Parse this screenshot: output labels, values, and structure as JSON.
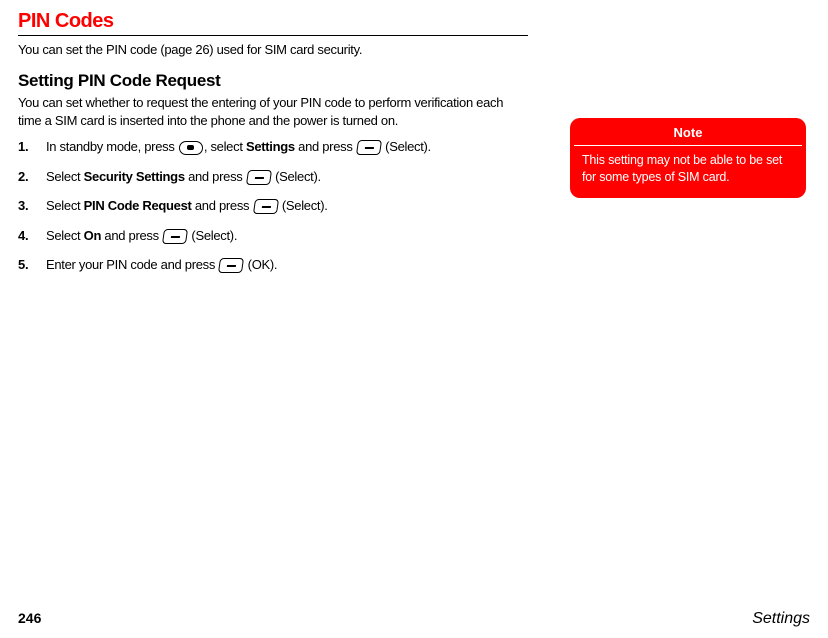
{
  "section": {
    "title": "PIN Codes",
    "intro": "You can set the PIN code (page 26) used for SIM card security."
  },
  "subsection": {
    "title": "Setting PIN Code Request",
    "desc": "You can set whether to request the entering of your PIN code to perform verification each time a SIM card is inserted into the phone and the power is turned on."
  },
  "steps": {
    "s1_a": "In standby mode, press ",
    "s1_b": ", select ",
    "s1_bold1": "Settings",
    "s1_c": " and press ",
    "s1_d": " (Select).",
    "s2_a": "Select ",
    "s2_bold1": "Security Settings",
    "s2_b": " and press ",
    "s2_c": " (Select).",
    "s3_a": "Select ",
    "s3_bold1": "PIN Code Request",
    "s3_b": " and press ",
    "s3_c": " (Select).",
    "s4_a": "Select ",
    "s4_bold1": "On",
    "s4_b": " and press ",
    "s4_c": " (Select).",
    "s5_a": "Enter your PIN code and press ",
    "s5_b": " (OK)."
  },
  "note": {
    "header": "Note",
    "body": "This setting may not be able to be set for some types of SIM card."
  },
  "footer": {
    "page": "246",
    "title": "Settings"
  }
}
